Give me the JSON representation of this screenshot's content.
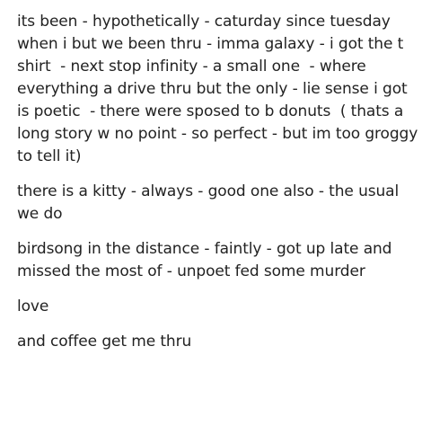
{
  "post": {
    "paragraphs": [
      "its been - hypothetically - caturday since tuesday when i but we been thru - imma galaxy - i got the t shirt  - next stop infinity - a small one  - where everything a drive thru but the only - lie sense i got is poetic  - there were sposed to b donuts  ( thats a long story w no point - so perfect - but im too groggy to tell it)",
      "there is a kitty - always - good one also - the usual we do",
      "birdsong in the distance - faintly - got up late and missed the most of - unpoet fed some murder",
      "love",
      "and coffee get me thru"
    ]
  },
  "colors": {
    "background": "#ffffff",
    "text": "#222222"
  }
}
